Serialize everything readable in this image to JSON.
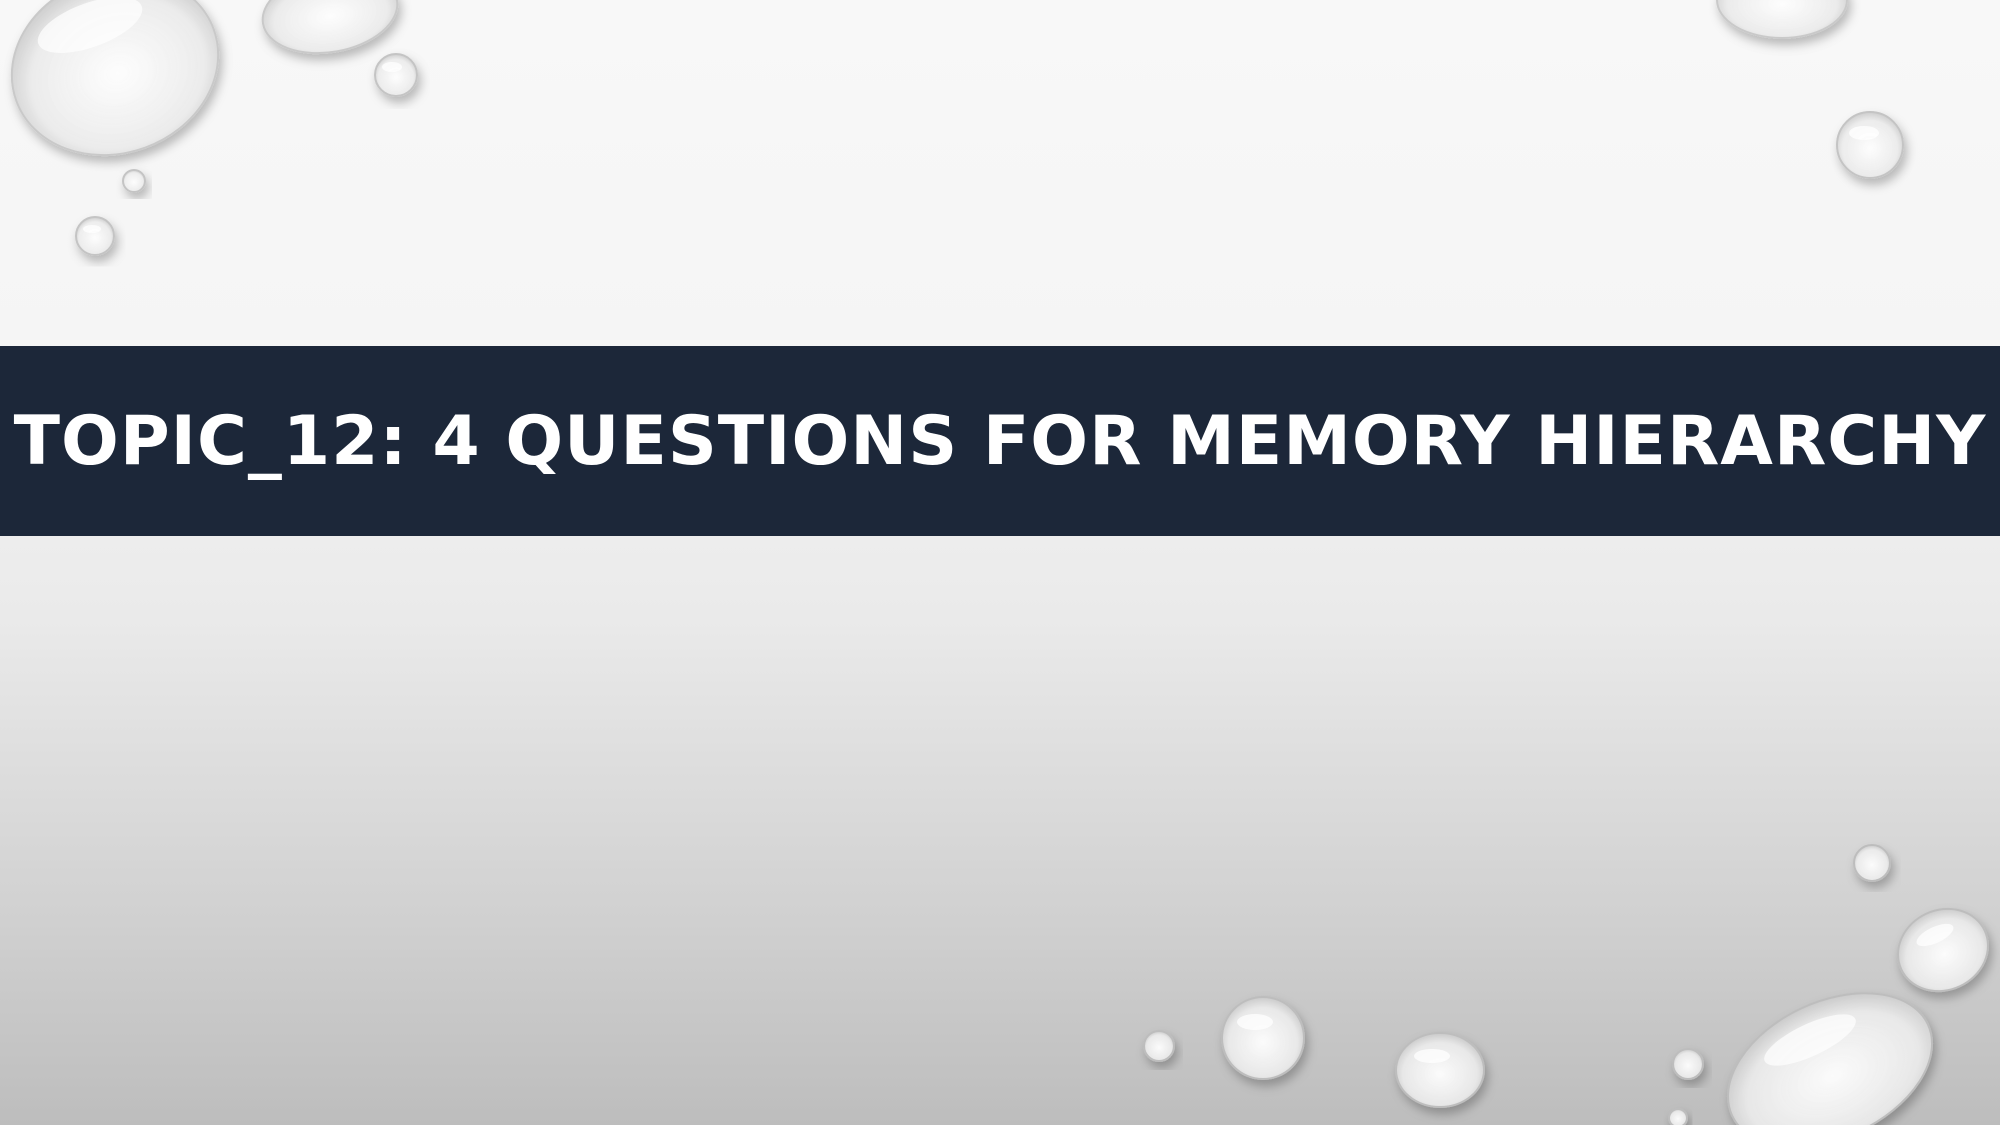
{
  "slide": {
    "title": "TOPIC_12: 4 QUESTIONS FOR MEMORY HIERARCHY"
  },
  "colors": {
    "title_band": "#1c2739",
    "title_text": "#ffffff",
    "background_top": "#f8f8f8",
    "background_bottom": "#bdbdbd"
  },
  "decorations": {
    "icon": "water-droplet-icon"
  }
}
